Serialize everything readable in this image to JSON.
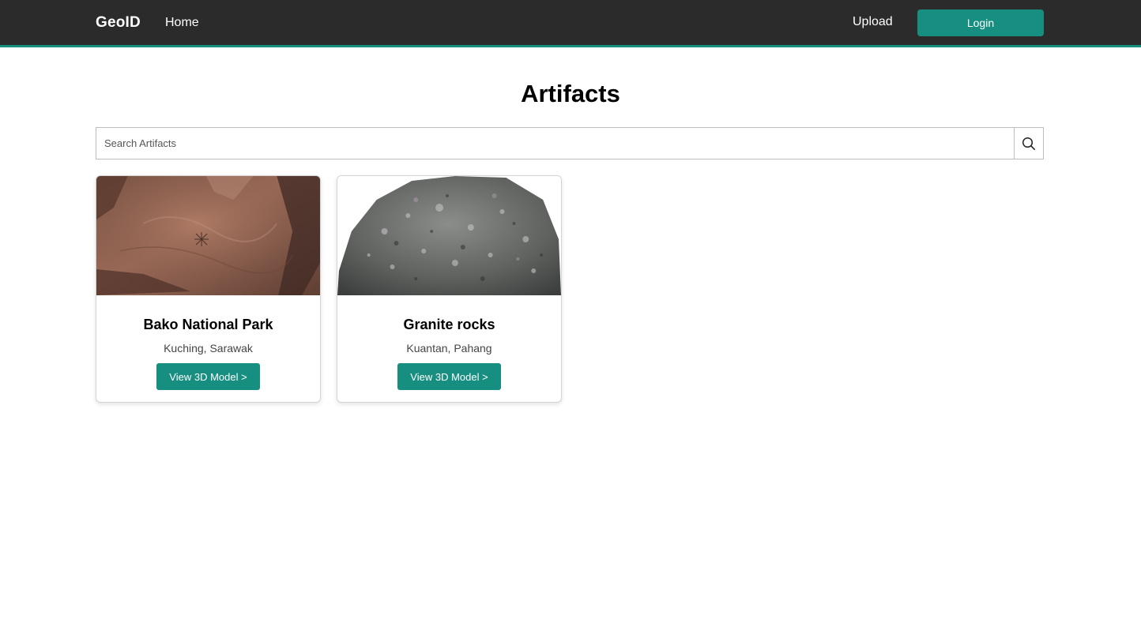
{
  "nav": {
    "brand": "GeoID",
    "home": "Home",
    "upload": "Upload",
    "login": "Login",
    "accent_color": "#178f80",
    "background_color": "#2b2b2b"
  },
  "page": {
    "title": "Artifacts"
  },
  "search": {
    "placeholder": "Search Artifacts",
    "value": "",
    "icon": "search-icon"
  },
  "artifacts": [
    {
      "title": "Bako National Park",
      "location": "Kuching, Sarawak",
      "button_label": "View 3D Model >",
      "image": "reddish sandstone rock with carved star petroglyph"
    },
    {
      "title": "Granite rocks",
      "location": "Kuantan, Pahang",
      "button_label": "View 3D Model >",
      "image": "grey speckled granite boulder"
    }
  ]
}
